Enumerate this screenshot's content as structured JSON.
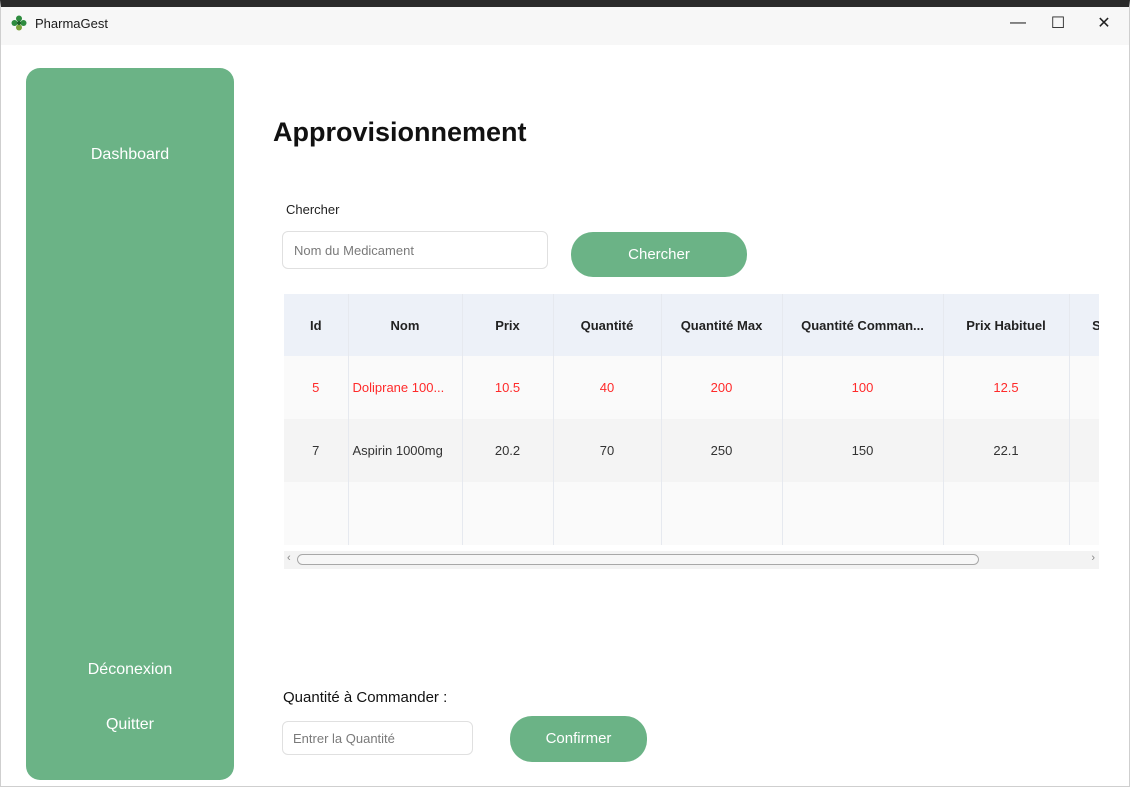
{
  "window": {
    "title": "PharmaGest",
    "controls": {
      "minimize": "—",
      "maximize": "☐",
      "close": "✕"
    }
  },
  "sidebar": {
    "items": [
      {
        "label": "Dashboard"
      },
      {
        "label": "Déconexion"
      },
      {
        "label": "Quitter"
      }
    ]
  },
  "page": {
    "title": "Approvisionnement"
  },
  "search": {
    "label": "Chercher",
    "placeholder": "Nom du Medicament",
    "value": "",
    "button_label": "Chercher"
  },
  "table": {
    "columns": [
      "Id",
      "Nom",
      "Prix",
      "Quantité",
      "Quantité Max",
      "Quantité Comman...",
      "Prix Habituel",
      "S"
    ],
    "rows": [
      [
        "5",
        "Doliprane 100...",
        "10.5",
        "40",
        "200",
        "100",
        "12.5",
        ""
      ],
      [
        "7",
        "Aspirin 1000mg",
        "20.2",
        "70",
        "250",
        "150",
        "22.1",
        ""
      ]
    ],
    "alert_row_color": "#ff2a2a"
  },
  "scrollbar": {
    "left_arrow": "‹",
    "right_arrow": "›"
  },
  "order": {
    "label": "Quantité à Commander :",
    "placeholder": "Entrer la Quantité",
    "value": "",
    "button_label": "Confirmer"
  },
  "colors": {
    "accent": "#6bb386",
    "header_bg": "#edf1f8",
    "alert_text": "#ff2a2a"
  }
}
